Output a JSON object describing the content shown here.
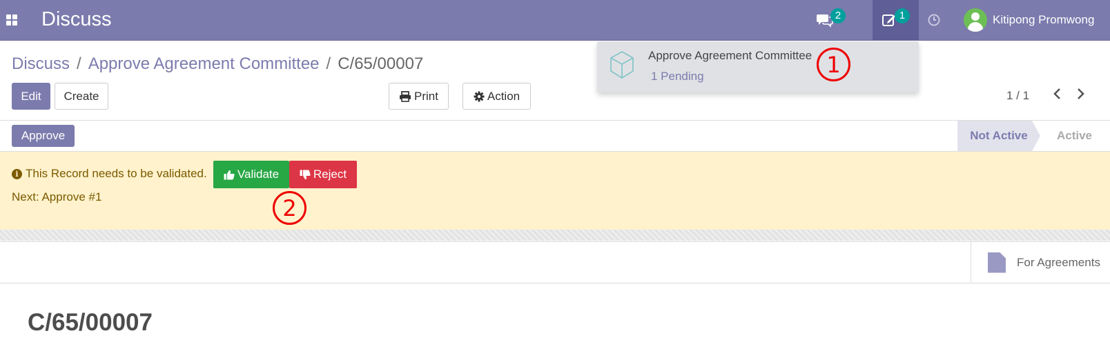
{
  "topbar": {
    "app_title": "Discuss",
    "messages_badge": "2",
    "activities_badge": "1",
    "user_name": "Kitipong Promwong"
  },
  "breadcrumb": {
    "items": [
      "Discuss",
      "Approve Agreement Committee"
    ],
    "current": "C/65/00007",
    "separator": "/"
  },
  "toolbar": {
    "edit_label": "Edit",
    "create_label": "Create",
    "print_label": "Print",
    "action_label": "Action"
  },
  "pager": {
    "value": "1 / 1"
  },
  "statusbar": {
    "approve_label": "Approve",
    "stages": [
      "Not Active",
      "Active"
    ],
    "current_stage": "Not Active"
  },
  "validation": {
    "message": "This Record needs to be validated.",
    "validate_label": "Validate",
    "reject_label": "Reject",
    "next_text": "Next: Approve #1"
  },
  "sheet": {
    "smart_button_label": "For Agreements",
    "record_title": "C/65/00007"
  },
  "activity_dropdown": {
    "title": "Approve Agreement Committee",
    "pending": "1 Pending"
  },
  "annotations": {
    "step1": "1",
    "step2": "2"
  },
  "colors": {
    "brand": "#7c7bad",
    "validate": "#28a745",
    "reject": "#dc3545",
    "alert_bg": "#fff2cc",
    "badge": "#00a09d"
  }
}
